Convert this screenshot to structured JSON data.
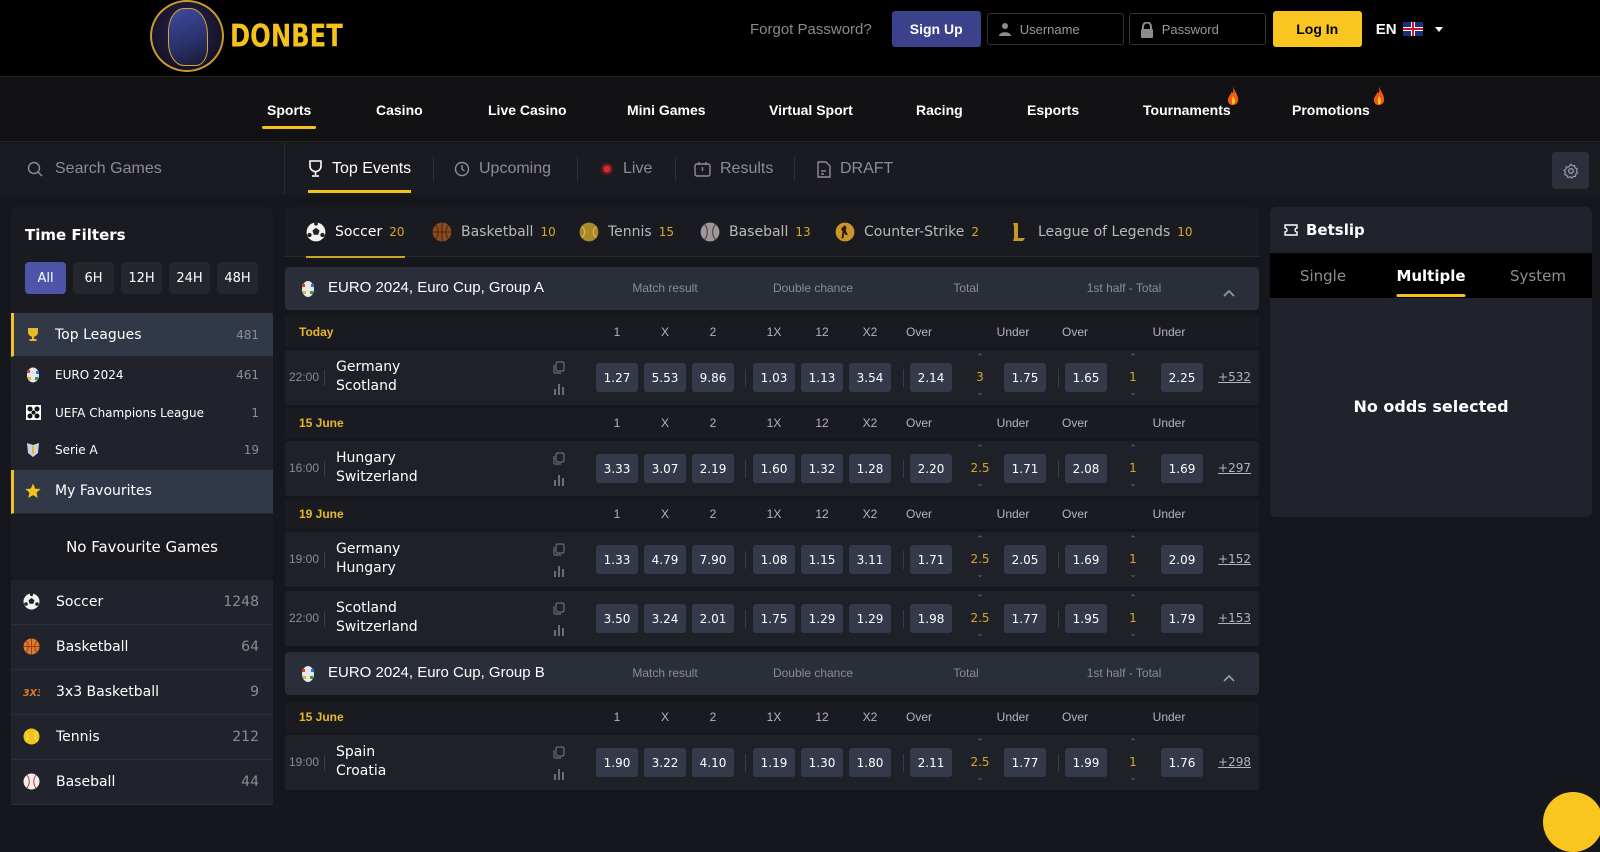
{
  "header": {
    "brand": "DONBET",
    "forgot_password": "Forgot Password?",
    "signup_label": "Sign Up",
    "username_placeholder": "Username",
    "password_placeholder": "Password",
    "login_label": "Log In",
    "language": "EN",
    "brand_color": "#f4c21a",
    "accent_color": "#3b418b"
  },
  "nav": {
    "items": [
      {
        "label": "Sports",
        "active": true
      },
      {
        "label": "Casino"
      },
      {
        "label": "Live Casino"
      },
      {
        "label": "Mini Games"
      },
      {
        "label": "Virtual Sport"
      },
      {
        "label": "Racing"
      },
      {
        "label": "Esports"
      },
      {
        "label": "Tournaments",
        "icon": "flame-icon"
      },
      {
        "label": "Promotions",
        "icon": "flame-icon"
      }
    ]
  },
  "subbar": {
    "search_placeholder": "Search Games",
    "tabs": [
      {
        "label": "Top Events",
        "icon": "trophy-icon",
        "active": true
      },
      {
        "label": "Upcoming",
        "icon": "clock-icon"
      },
      {
        "label": "Live",
        "icon": "live-dot-icon"
      },
      {
        "label": "Results",
        "icon": "results-icon"
      },
      {
        "label": "DRAFT",
        "icon": "draft-icon"
      }
    ]
  },
  "sidebar": {
    "time_filters_title": "Time Filters",
    "time_filters": [
      "All",
      "6H",
      "12H",
      "24H",
      "48H"
    ],
    "active_filter": "All",
    "top_leagues": {
      "label": "Top Leagues",
      "count": "481"
    },
    "leagues": [
      {
        "label": "EURO 2024",
        "count": "461",
        "icon": "euro-2024-icon"
      },
      {
        "label": "UEFA Champions League",
        "count": "1",
        "icon": "champions-league-icon"
      },
      {
        "label": "Serie A",
        "count": "19",
        "icon": "serie-a-icon"
      }
    ],
    "favourites_label": "My Favourites",
    "no_favourites": "No Favourite Games",
    "sports": [
      {
        "label": "Soccer",
        "count": "1248",
        "icon": "soccer-ball-icon"
      },
      {
        "label": "Basketball",
        "count": "64",
        "icon": "basketball-icon"
      },
      {
        "label": "3x3 Basketball",
        "count": "9",
        "icon": "3x3-basketball-icon"
      },
      {
        "label": "Tennis",
        "count": "212",
        "icon": "tennis-ball-icon"
      },
      {
        "label": "Baseball",
        "count": "44",
        "icon": "baseball-icon"
      }
    ]
  },
  "sport_tabs": [
    {
      "label": "Soccer",
      "count": "20",
      "icon": "soccer-ball-icon",
      "active": true
    },
    {
      "label": "Basketball",
      "count": "10",
      "icon": "basketball-icon"
    },
    {
      "label": "Tennis",
      "count": "15",
      "icon": "tennis-ball-icon"
    },
    {
      "label": "Baseball",
      "count": "13",
      "icon": "baseball-icon"
    },
    {
      "label": "Counter-Strike",
      "count": "2",
      "icon": "counter-strike-icon"
    },
    {
      "label": "League of Legends",
      "count": "10",
      "icon": "league-of-legends-icon"
    }
  ],
  "market_headers": [
    "Match result",
    "Double chance",
    "Total",
    "1st half - Total"
  ],
  "columns": [
    "1",
    "X",
    "2",
    "1X",
    "12",
    "X2",
    "Over",
    "Under",
    "Over",
    "Under"
  ],
  "leagues": [
    {
      "name": "EURO 2024, Euro Cup, Group A",
      "groups": [
        {
          "date": "Today",
          "matches": [
            {
              "time": "22:00",
              "home": "Germany",
              "away": "Scotland",
              "odds": [
                "1.27",
                "5.53",
                "9.86",
                "1.03",
                "1.13",
                "3.54",
                "2.14",
                "1.75",
                "1.65",
                "2.25"
              ],
              "total_line": "3",
              "half_line": "1",
              "more": "+532"
            }
          ]
        },
        {
          "date": "15 June",
          "matches": [
            {
              "time": "16:00",
              "home": "Hungary",
              "away": "Switzerland",
              "odds": [
                "3.33",
                "3.07",
                "2.19",
                "1.60",
                "1.32",
                "1.28",
                "2.20",
                "1.71",
                "2.08",
                "1.69"
              ],
              "total_line": "2.5",
              "half_line": "1",
              "more": "+297"
            }
          ]
        },
        {
          "date": "19 June",
          "matches": [
            {
              "time": "19:00",
              "home": "Germany",
              "away": "Hungary",
              "odds": [
                "1.33",
                "4.79",
                "7.90",
                "1.08",
                "1.15",
                "3.11",
                "1.71",
                "2.05",
                "1.69",
                "2.09"
              ],
              "total_line": "2.5",
              "half_line": "1",
              "more": "+152"
            },
            {
              "time": "22:00",
              "home": "Scotland",
              "away": "Switzerland",
              "odds": [
                "3.50",
                "3.24",
                "2.01",
                "1.75",
                "1.29",
                "1.29",
                "1.98",
                "1.77",
                "1.95",
                "1.79"
              ],
              "total_line": "2.5",
              "half_line": "1",
              "more": "+153"
            }
          ]
        }
      ]
    },
    {
      "name": "EURO 2024, Euro Cup, Group B",
      "groups": [
        {
          "date": "15 June",
          "matches": [
            {
              "time": "19:00",
              "home": "Spain",
              "away": "Croatia",
              "odds": [
                "1.90",
                "3.22",
                "4.10",
                "1.19",
                "1.30",
                "1.80",
                "2.11",
                "1.77",
                "1.99",
                "1.76"
              ],
              "total_line": "2.5",
              "half_line": "1",
              "more": "+298"
            }
          ]
        }
      ]
    }
  ],
  "betslip": {
    "title": "Betslip",
    "tabs": [
      "Single",
      "Multiple",
      "System"
    ],
    "active_tab": "Multiple",
    "empty_message": "No odds selected"
  }
}
